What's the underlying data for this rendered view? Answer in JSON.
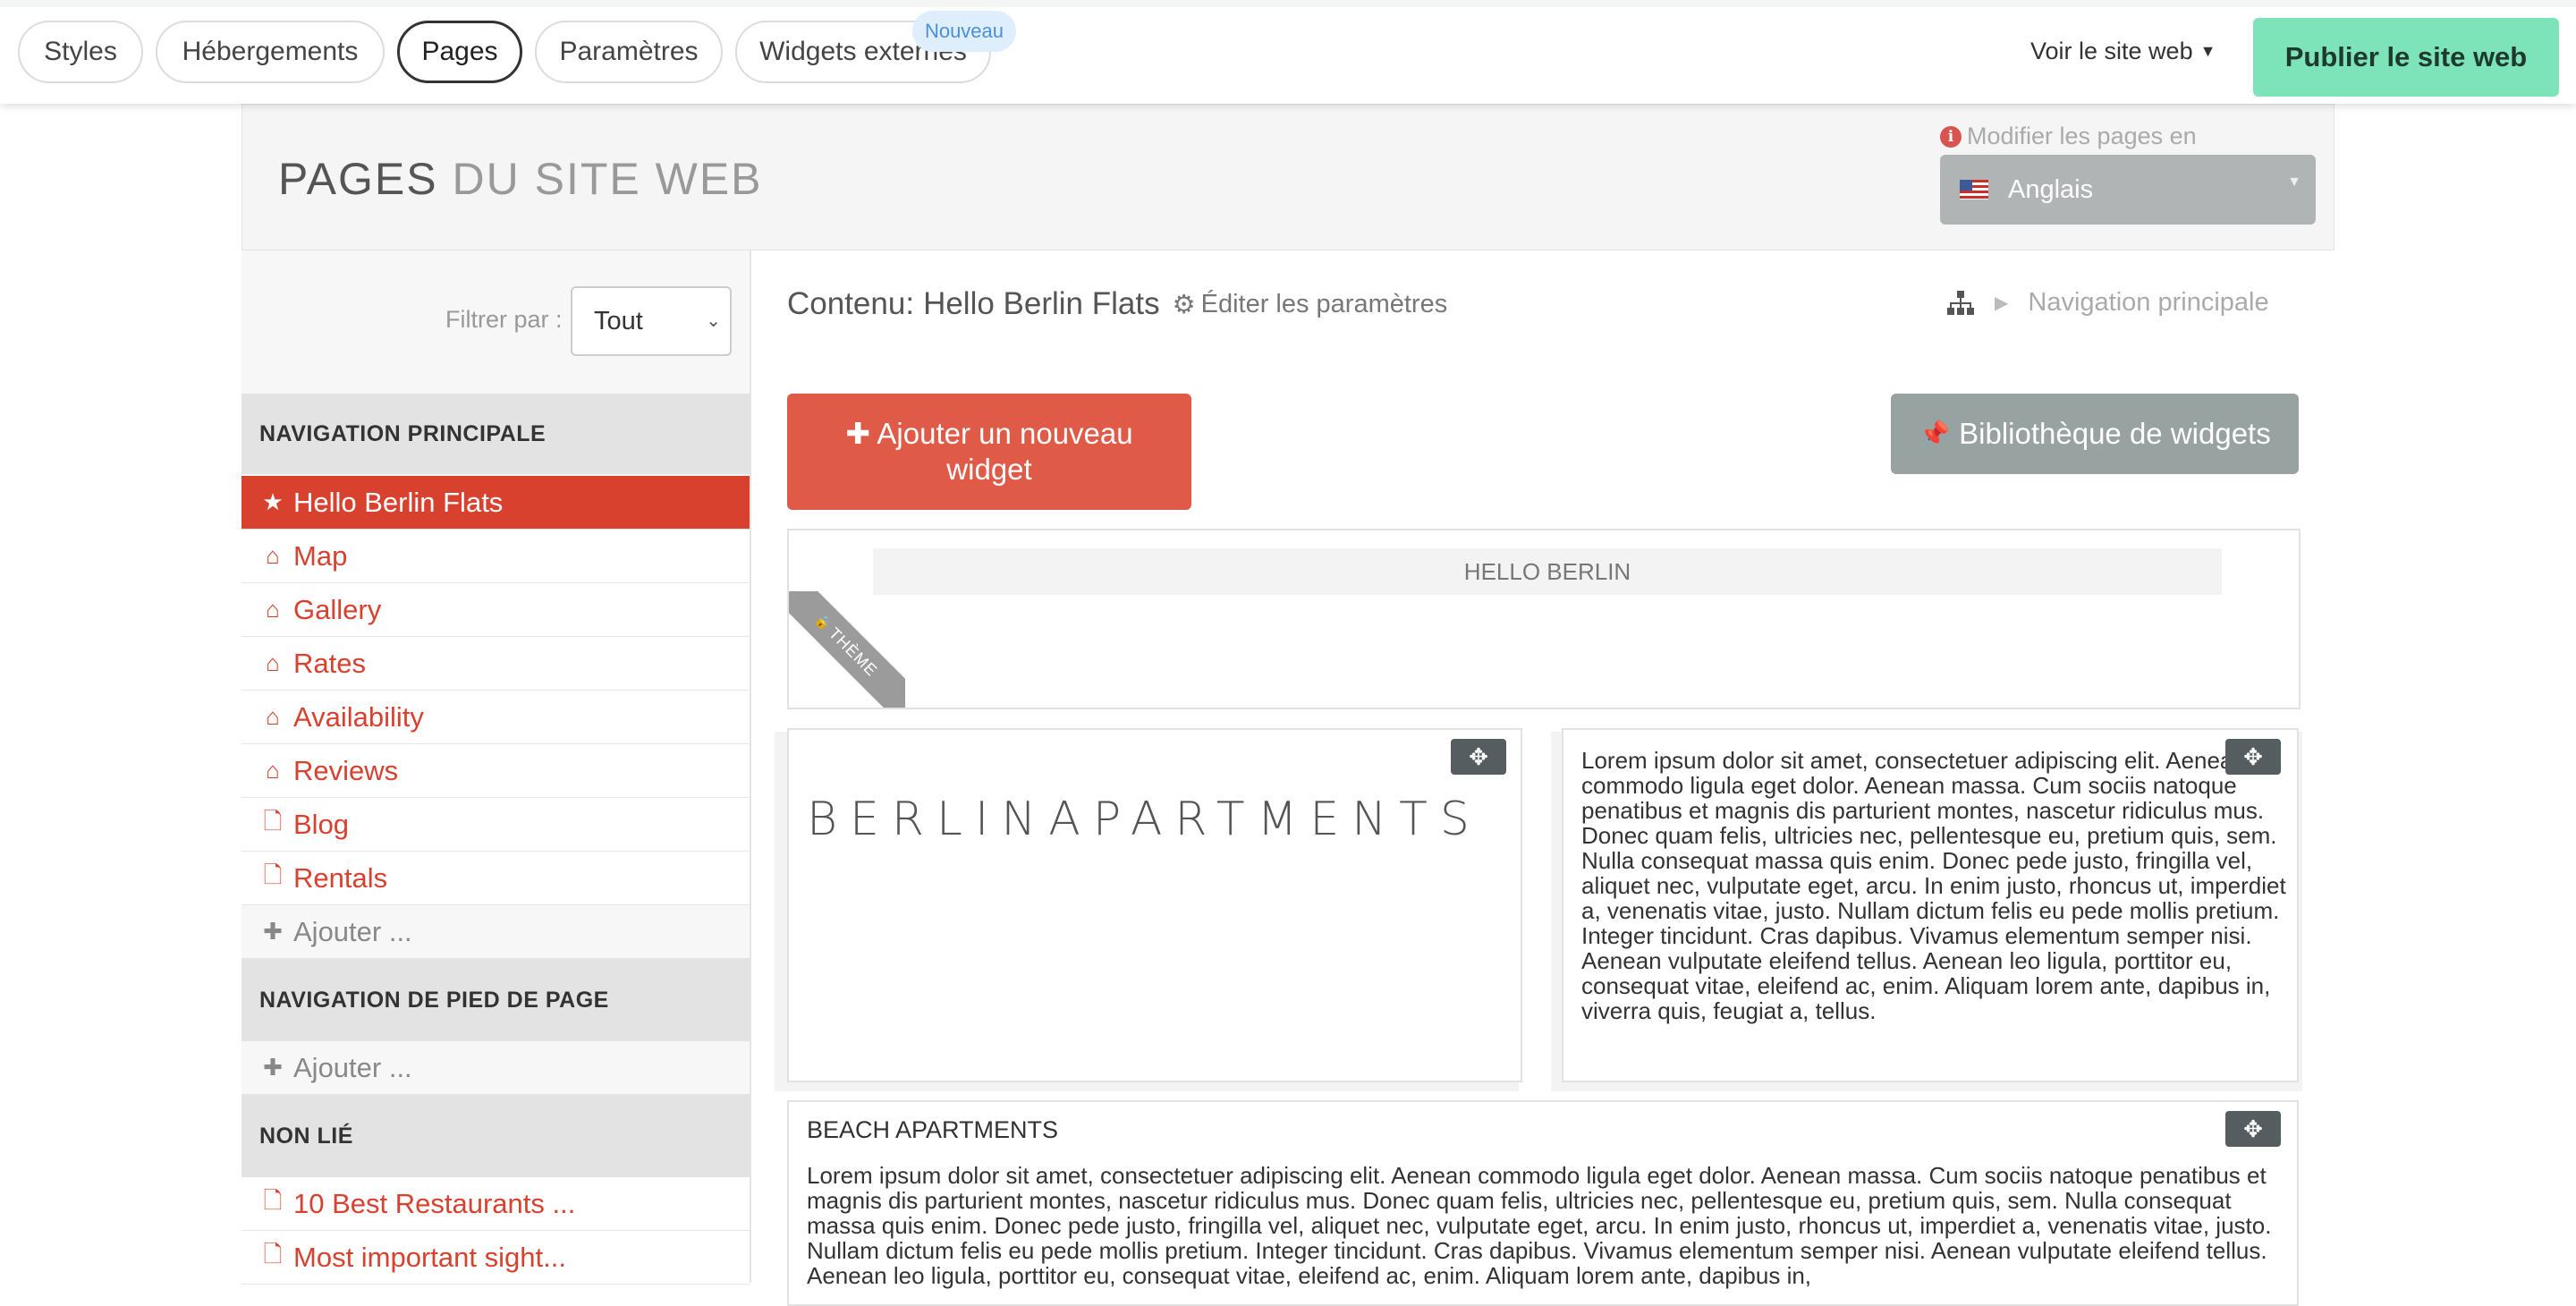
{
  "topbar": {
    "tabs": [
      {
        "label": "Styles"
      },
      {
        "label": "Hébergements"
      },
      {
        "label": "Pages"
      },
      {
        "label": "Paramètres"
      },
      {
        "label": "Widgets externes"
      }
    ],
    "new_badge": "Nouveau",
    "view_site": "Voir le site web",
    "publish": "Publier le site web"
  },
  "header": {
    "title_dark": "PAGES",
    "title_light": "DU SITE WEB",
    "lang_label": "Modifier les pages en",
    "lang_value": "Anglais"
  },
  "sidebar": {
    "filter_label": "Filtrer par :",
    "filter_value": "Tout",
    "sections": [
      {
        "title": "NAVIGATION PRINCIPALE"
      },
      {
        "title": "NAVIGATION DE PIED DE PAGE"
      },
      {
        "title": "NON LIÉ"
      }
    ],
    "main_items": [
      {
        "label": "Hello Berlin Flats",
        "icon": "star-icon"
      },
      {
        "label": "Map",
        "icon": "home-icon"
      },
      {
        "label": "Gallery",
        "icon": "home-icon"
      },
      {
        "label": "Rates",
        "icon": "home-icon"
      },
      {
        "label": "Availability",
        "icon": "home-icon"
      },
      {
        "label": "Reviews",
        "icon": "home-icon"
      },
      {
        "label": "Blog",
        "icon": "file-icon"
      },
      {
        "label": "Rentals",
        "icon": "file-icon"
      }
    ],
    "add_label": "Ajouter ...",
    "unlinked_items": [
      {
        "label": "10 Best Restaurants ...",
        "icon": "file-icon"
      },
      {
        "label": "Most important sight...",
        "icon": "file-icon"
      }
    ]
  },
  "main": {
    "content_prefix": "Contenu:",
    "content_name": "Hello Berlin Flats",
    "edit_params": "Éditer les paramètres",
    "breadcrumb": "Navigation principale",
    "add_widget": "Ajouter un nouveau widget",
    "widget_library": "Bibliothèque de widgets",
    "hello_bar": "HELLO BERLIN",
    "theme_ribbon": "THÈME",
    "logo_text": "BERLINAPARTMENTS",
    "lorem_right": "Lorem ipsum dolor sit amet, consectetuer adipiscing elit. Aenean commodo ligula eget dolor. Aenean massa. Cum sociis natoque penatibus et magnis dis parturient montes, nascetur ridiculus mus. Donec quam felis, ultricies nec, pellentesque eu, pretium quis, sem. Nulla consequat massa quis enim. Donec pede justo, fringilla vel, aliquet nec, vulputate eget, arcu. In enim justo, rhoncus ut, imperdiet a, venenatis vitae, justo. Nullam dictum felis eu pede mollis pretium. Integer tincidunt. Cras dapibus. Vivamus elementum semper nisi. Aenean vulputate eleifend tellus. Aenean leo ligula, porttitor eu, consequat vitae, eleifend ac, enim. Aliquam lorem ante, dapibus in, viverra quis, feugiat a, tellus.",
    "beach_title": "BEACH APARTMENTS",
    "lorem_beach": "Lorem ipsum dolor sit amet, consectetuer adipiscing elit. Aenean commodo ligula eget dolor. Aenean massa. Cum sociis natoque penatibus et magnis dis parturient montes, nascetur ridiculus mus. Donec quam felis, ultricies nec, pellentesque eu, pretium quis, sem. Nulla consequat massa quis enim. Donec pede justo, fringilla vel, aliquet nec, vulputate eget, arcu. In enim justo, rhoncus ut, imperdiet a, venenatis vitae, justo. Nullam dictum felis eu pede mollis pretium. Integer tincidunt. Cras dapibus. Vivamus elementum semper nisi. Aenean vulputate eleifend tellus. Aenean leo ligula, porttitor eu, consequat vitae, eleifend ac, enim. Aliquam lorem ante, dapibus in,"
  },
  "colors": {
    "accent": "#d9412f",
    "add_button": "#e05a48",
    "publish": "#7de3b8",
    "library_button": "#98a2a1"
  }
}
